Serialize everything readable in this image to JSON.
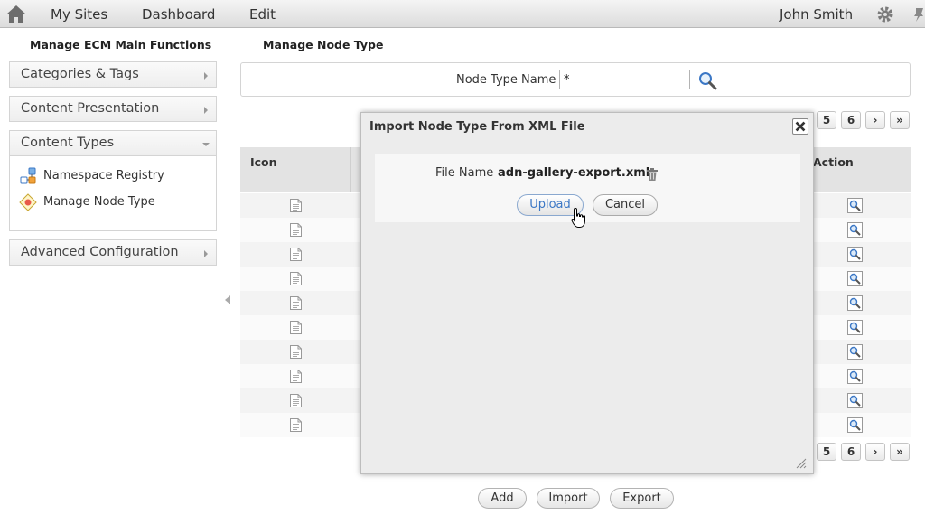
{
  "topbar": {
    "nav": [
      "My Sites",
      "Dashboard",
      "Edit"
    ],
    "user": "John Smith"
  },
  "left": {
    "title": "Manage ECM Main Functions",
    "sections": [
      {
        "label": "Categories & Tags",
        "expanded": false
      },
      {
        "label": "Content Presentation",
        "expanded": false
      },
      {
        "label": "Content Types",
        "expanded": true
      },
      {
        "label": "Advanced Configuration",
        "expanded": false
      }
    ],
    "content_types_items": [
      {
        "label": "Namespace Registry",
        "icon": "namespace-icon"
      },
      {
        "label": "Manage Node Type",
        "icon": "node-type-icon"
      }
    ]
  },
  "main": {
    "title": "Manage Node Type",
    "search": {
      "label": "Node Type Name",
      "value": "*"
    },
    "pager": [
      "5",
      "6",
      "›",
      "»"
    ],
    "grid": {
      "columns": [
        "Icon",
        "Action"
      ],
      "row_count": 10
    },
    "buttons": [
      "Add",
      "Import",
      "Export"
    ]
  },
  "dialog": {
    "title": "Import Node Type From XML File",
    "file_label": "File Name",
    "file_name": "adn-gallery-export.xml",
    "upload_label": "Upload",
    "cancel_label": "Cancel"
  },
  "colors": {
    "accent": "#3b77c5",
    "topbar": "#e6e6e6",
    "dialog_bg": "#ececec"
  }
}
